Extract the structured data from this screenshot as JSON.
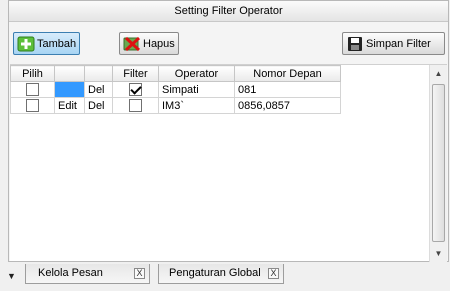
{
  "panel": {
    "title": "Setting Filter Operator"
  },
  "toolbar": {
    "add_label": "Tambah",
    "delete_label": "Hapus",
    "save_label": "Simpan Filter"
  },
  "grid": {
    "columns": [
      "Pilih",
      "",
      "",
      "Filter",
      "Operator",
      "Nomor Depan"
    ],
    "rows": [
      {
        "pilih": false,
        "edit": "",
        "del": "Del",
        "filter": true,
        "operator": "Simpati",
        "prefix": "081",
        "selected_cell": true
      },
      {
        "pilih": false,
        "edit": "Edit",
        "del": "Del",
        "filter": false,
        "operator": "IM3`",
        "prefix": "0856,0857",
        "selected_cell": false
      }
    ]
  },
  "tabs": [
    {
      "label": "Kelola Pesan",
      "close": "X"
    },
    {
      "label": "Pengaturan Global",
      "close": "X"
    }
  ],
  "colors": {
    "selection": "#3399ff",
    "active_button": "#a7d4f3"
  }
}
